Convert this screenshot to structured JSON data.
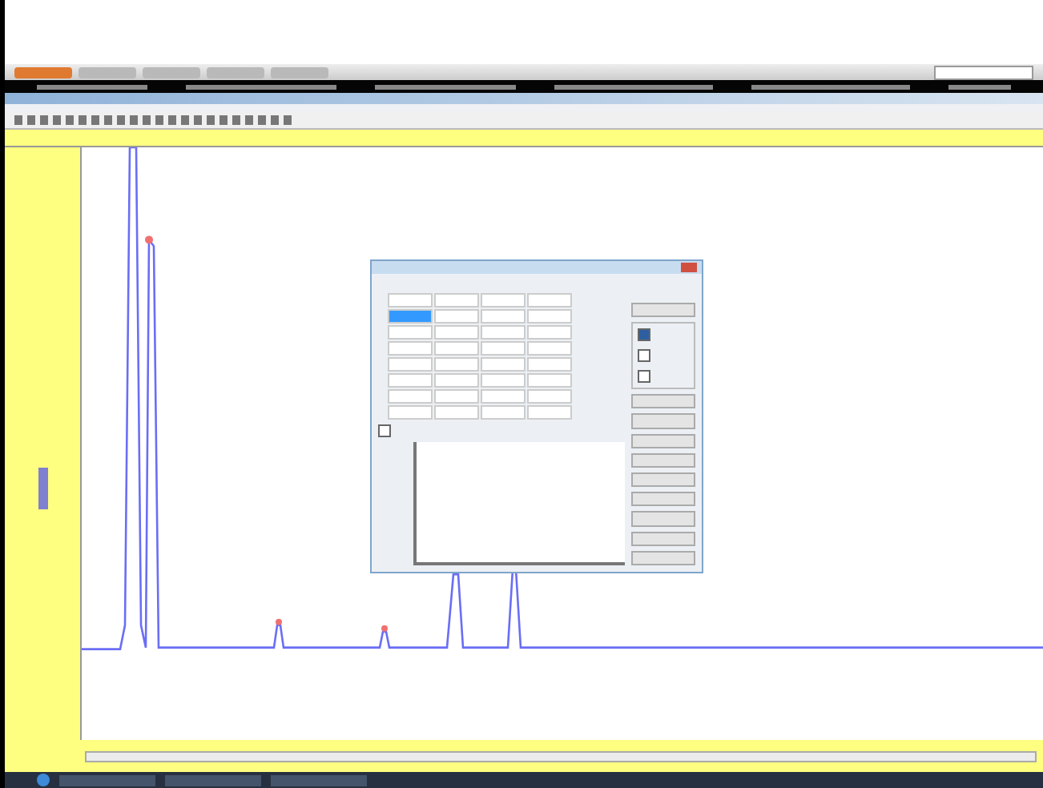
{
  "browser": {
    "toolbar_buttons": [
      {
        "selected": true
      },
      {
        "selected": false
      },
      {
        "selected": false
      },
      {
        "selected": false
      },
      {
        "selected": false
      }
    ]
  },
  "dialog": {
    "grid_rows": [
      {
        "selected": false
      },
      {
        "selected": true
      },
      {
        "selected": false
      },
      {
        "selected": false
      },
      {
        "selected": false
      },
      {
        "selected": false
      },
      {
        "selected": false
      },
      {
        "selected": false
      }
    ],
    "options": [
      {
        "checked": true
      },
      {
        "checked": false
      },
      {
        "checked": false
      }
    ],
    "sort_checked": false
  }
}
